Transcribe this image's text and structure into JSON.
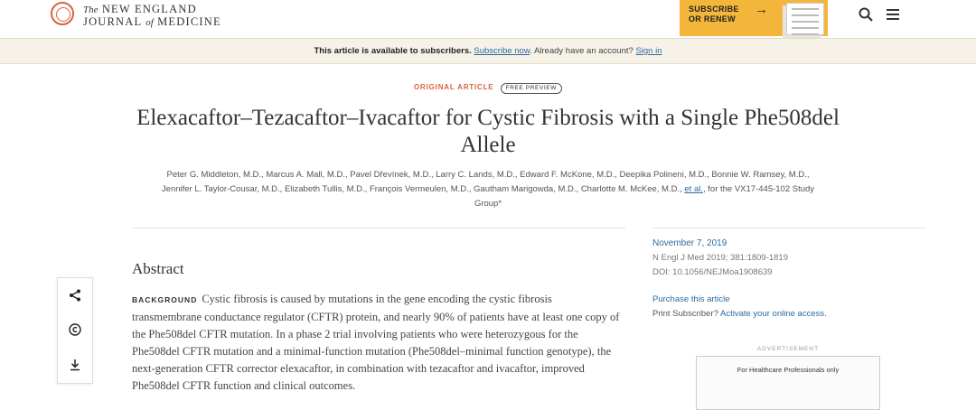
{
  "header": {
    "logo_line1_small": "The",
    "logo_line1": "NEW ENGLAND",
    "logo_line2a": "JOURNAL",
    "logo_line2_small": "of",
    "logo_line2b": "MEDICINE",
    "subscribe_line1": "SUBSCRIBE",
    "subscribe_line2": "OR RENEW",
    "subscribe_arrow": "→"
  },
  "subscriber_bar": {
    "message": "This article is available to subscribers.",
    "subscribe_link": "Subscribe now",
    "account_text": ". Already have an account?",
    "signin_link": "Sign in"
  },
  "article": {
    "type": "ORIGINAL ARTICLE",
    "badge": "FREE PREVIEW",
    "title": "Elexacaftor–Tezacaftor–Ivacaftor for Cystic Fibrosis with a Single Phe508del Allele",
    "authors_line1": "Peter G. Middleton, M.D., Marcus A. Mall, M.D., Pavel Dřevínek, M.D., Larry C. Lands, M.D., Edward F. McKone, M.D., Deepika Polineni, M.D., Bonnie W. Ramsey, M.D.,",
    "authors_line2": "Jennifer L. Taylor-Cousar, M.D., Elizabeth Tullis, M.D., François Vermeulen, M.D., Gautham Marigowda, M.D., Charlotte M. McKee, M.D.,",
    "authors_etal": "et al.",
    "authors_tail": ", for the VX17-445-102 Study",
    "authors_line3": "Group*"
  },
  "abstract": {
    "heading": "Abstract",
    "section_label": "BACKGROUND",
    "background_text": "Cystic fibrosis is caused by mutations in the gene encoding the cystic fibrosis transmembrane conductance regulator (CFTR) protein, and nearly 90% of patients have at least one copy of the Phe508del CFTR mutation. In a phase 2 trial involving patients who were heterozygous for the Phe508del CFTR mutation and a minimal-function mutation (Phe508del–minimal function genotype), the next-generation CFTR corrector elexacaftor, in combination with tezacaftor and ivacaftor, improved Phe508del CFTR function and clinical outcomes."
  },
  "sidebar": {
    "date": "November 7, 2019",
    "citation": "N Engl J Med 2019; 381:1809-1819",
    "doi": "DOI: 10.1056/NEJMoa1908639",
    "purchase_link": "Purchase this article",
    "print_text": "Print Subscriber?",
    "activate_link": "Activate your online access.",
    "ad_label": "ADVERTISEMENT",
    "ad_text": "For Healthcare Professionals only"
  },
  "icons": [
    "seal-logo-icon",
    "arrow-right-icon",
    "search-icon",
    "menu-icon",
    "share-icon",
    "copyright-icon",
    "download-icon"
  ],
  "colors": {
    "accent_orange": "#d9613f",
    "subscribe_yellow": "#f4b63a",
    "link_blue": "#2e6a9e",
    "subbar_bg": "#f6f2e8"
  }
}
